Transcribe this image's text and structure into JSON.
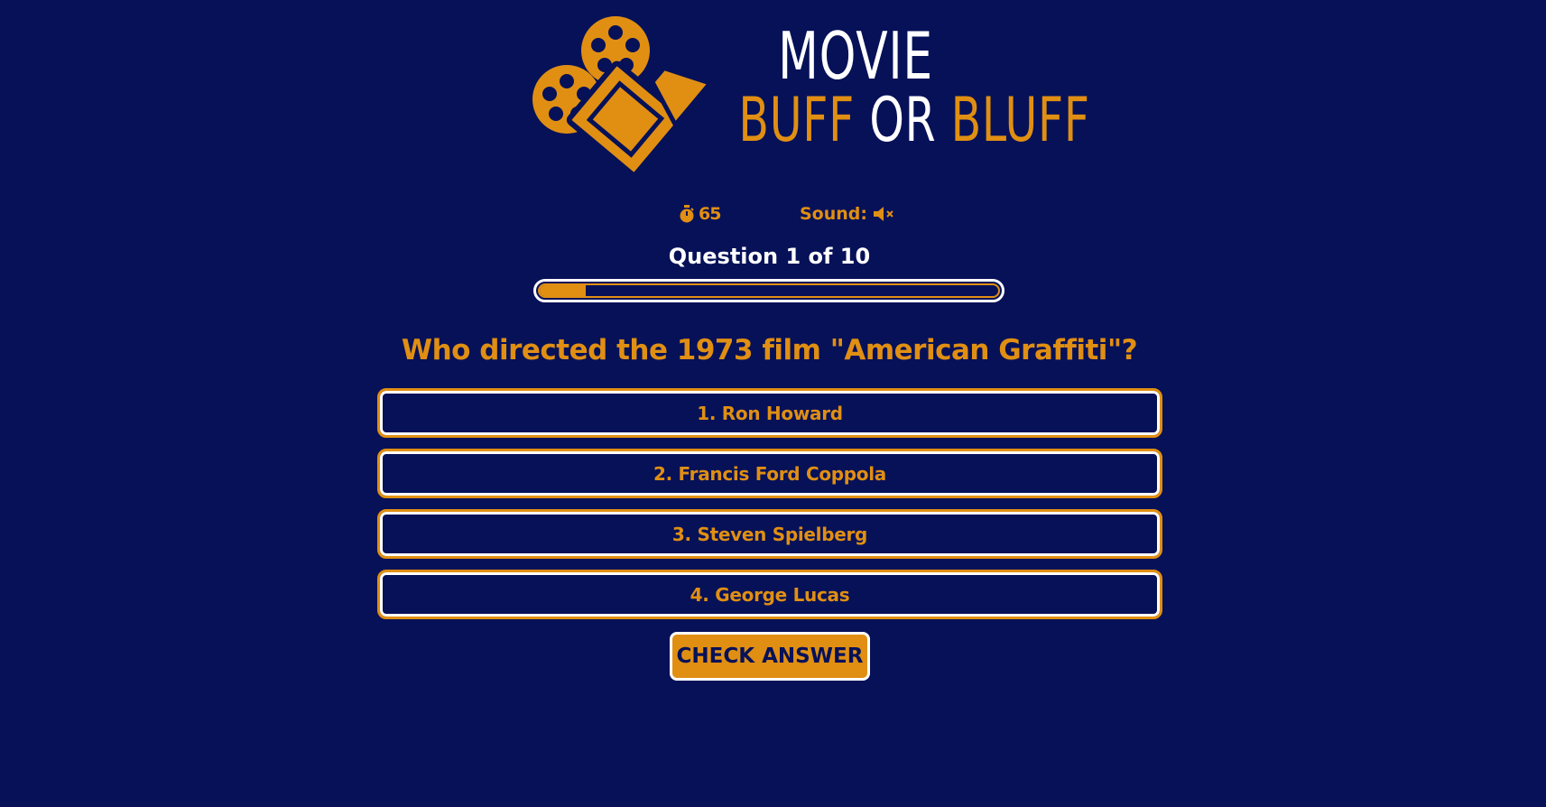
{
  "logo": {
    "line1": "MOVIE",
    "line2_part1": "BUFF",
    "line2_part2": "OR",
    "line2_part3": "BLUFF",
    "icon": "film-camera-icon"
  },
  "status": {
    "timer_icon": "stopwatch-icon",
    "timer_value": "65",
    "sound_label": "Sound:",
    "sound_icon": "speaker-muted-icon"
  },
  "progress": {
    "counter_text": "Question 1 of 10",
    "fraction": 0.1
  },
  "question": {
    "text": "Who directed the 1973 film \"American Graffiti\"?"
  },
  "answers": [
    {
      "label": "1. Ron Howard"
    },
    {
      "label": "2. Francis Ford Coppola"
    },
    {
      "label": "3. Steven Spielberg"
    },
    {
      "label": "4. George Lucas"
    }
  ],
  "check_button": {
    "label": "CHECK ANSWER"
  },
  "colors": {
    "background": "#061158",
    "accent": "#e08f13",
    "text_light": "#ffffff"
  }
}
